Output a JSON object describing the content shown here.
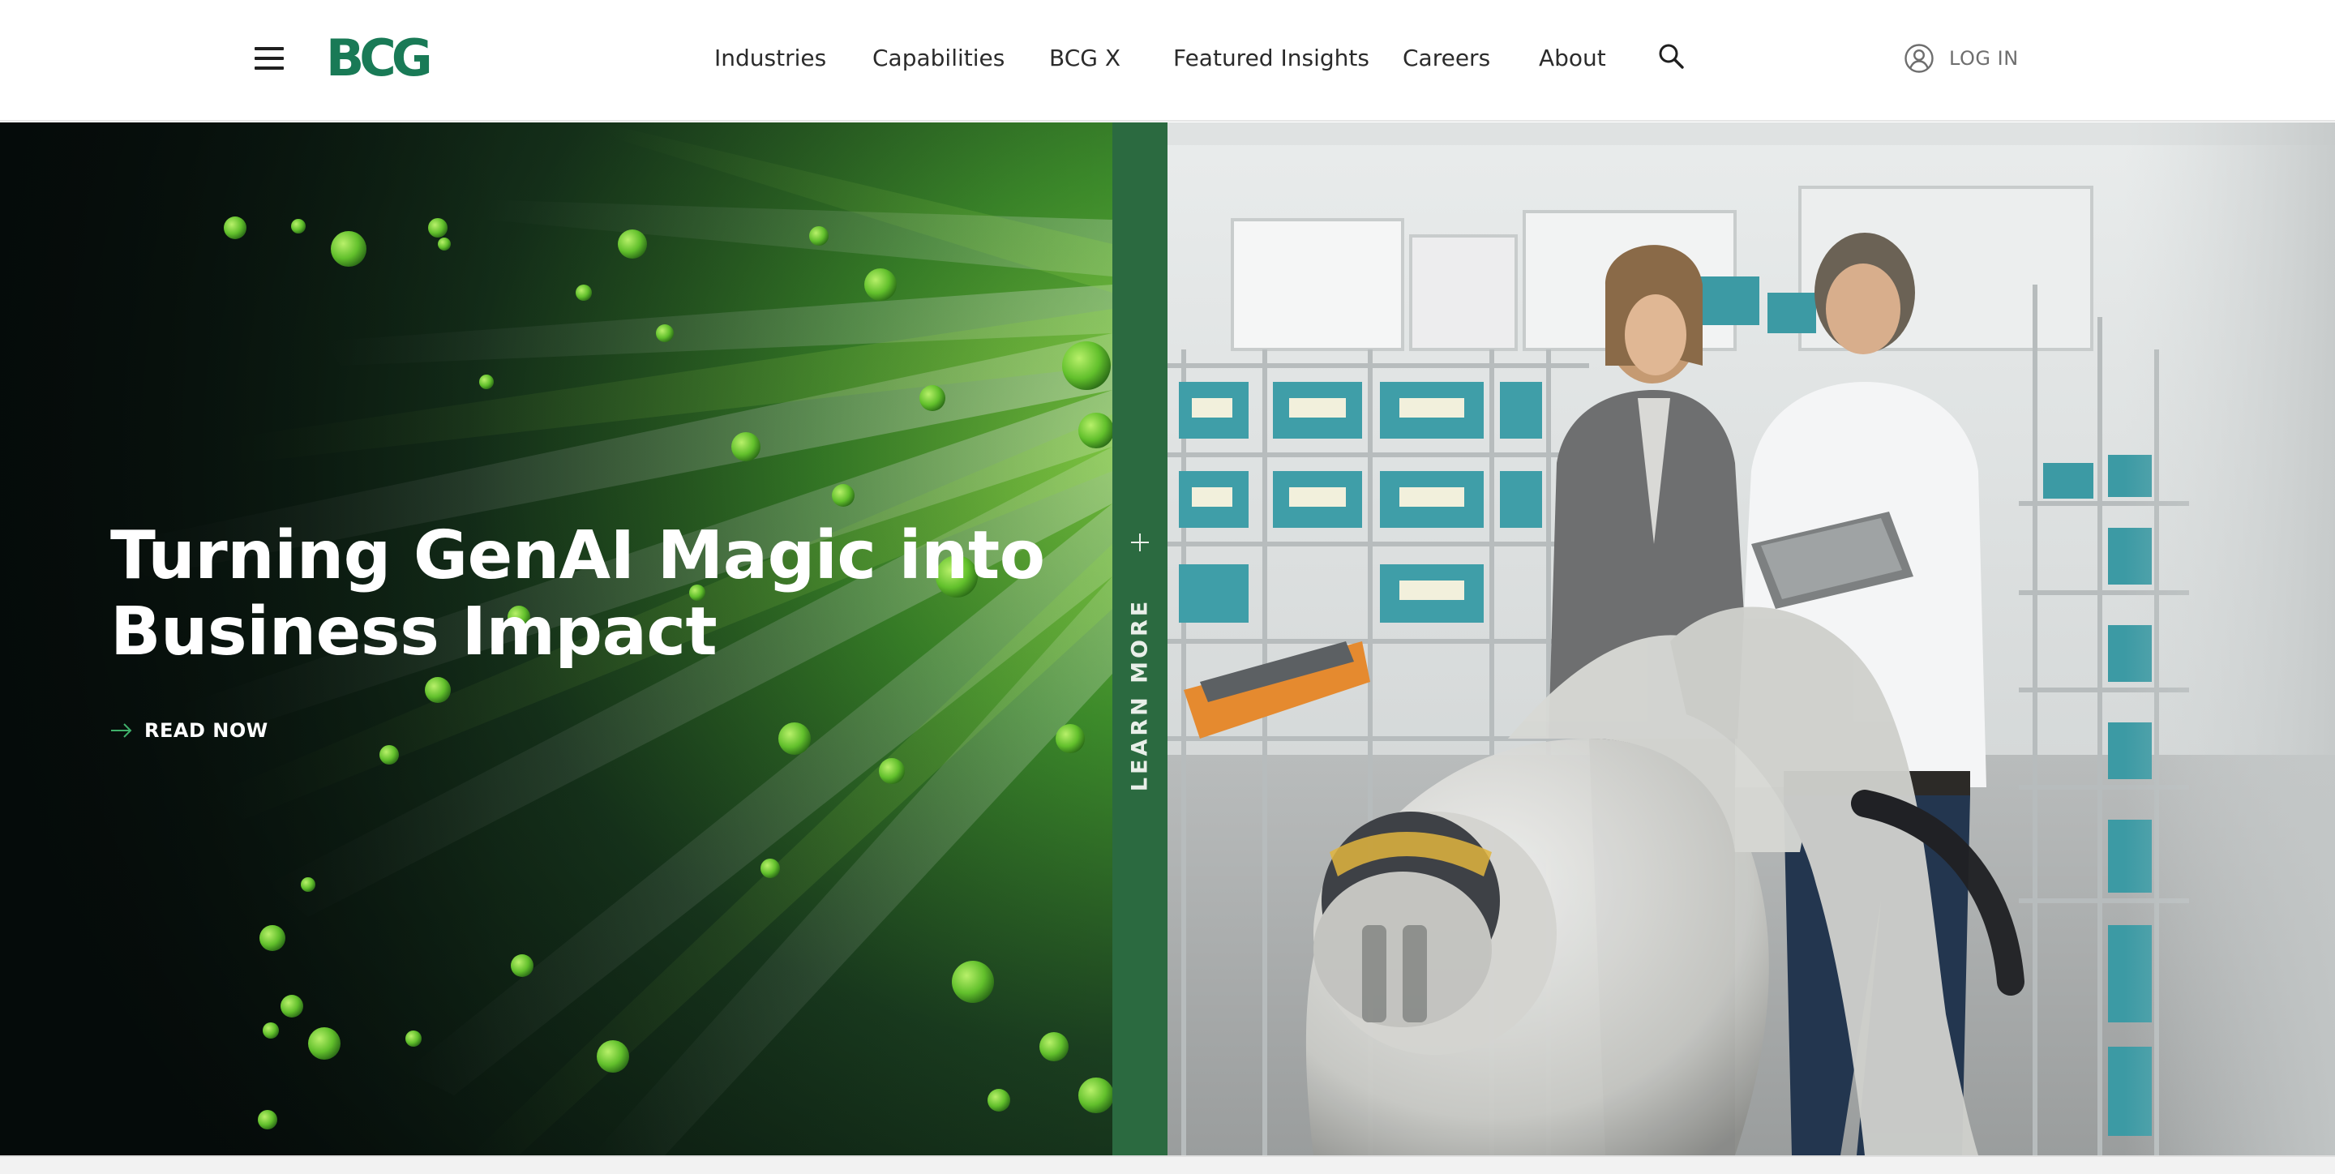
{
  "brand": {
    "logo_text": "BCG",
    "accent_color": "#197a56",
    "learn_more_strip_color": "#2b6a40"
  },
  "header": {
    "menu_icon": "hamburger-menu-icon",
    "nav": [
      {
        "label": "Industries"
      },
      {
        "label": "Capabilities"
      },
      {
        "label": "BCG X"
      },
      {
        "label": "Featured Insights"
      },
      {
        "label": "Careers"
      },
      {
        "label": "About"
      }
    ],
    "search_icon": "search-icon",
    "login": {
      "icon": "user-circle-icon",
      "label": "LOG IN"
    }
  },
  "hero": {
    "title_line1": "Turning GenAI Magic into",
    "title_line2": "Business Impact",
    "cta": {
      "icon": "arrow-right-icon",
      "label": "READ NOW"
    },
    "learn_more": {
      "icon": "plus-icon",
      "label": "LEARN MORE"
    }
  }
}
